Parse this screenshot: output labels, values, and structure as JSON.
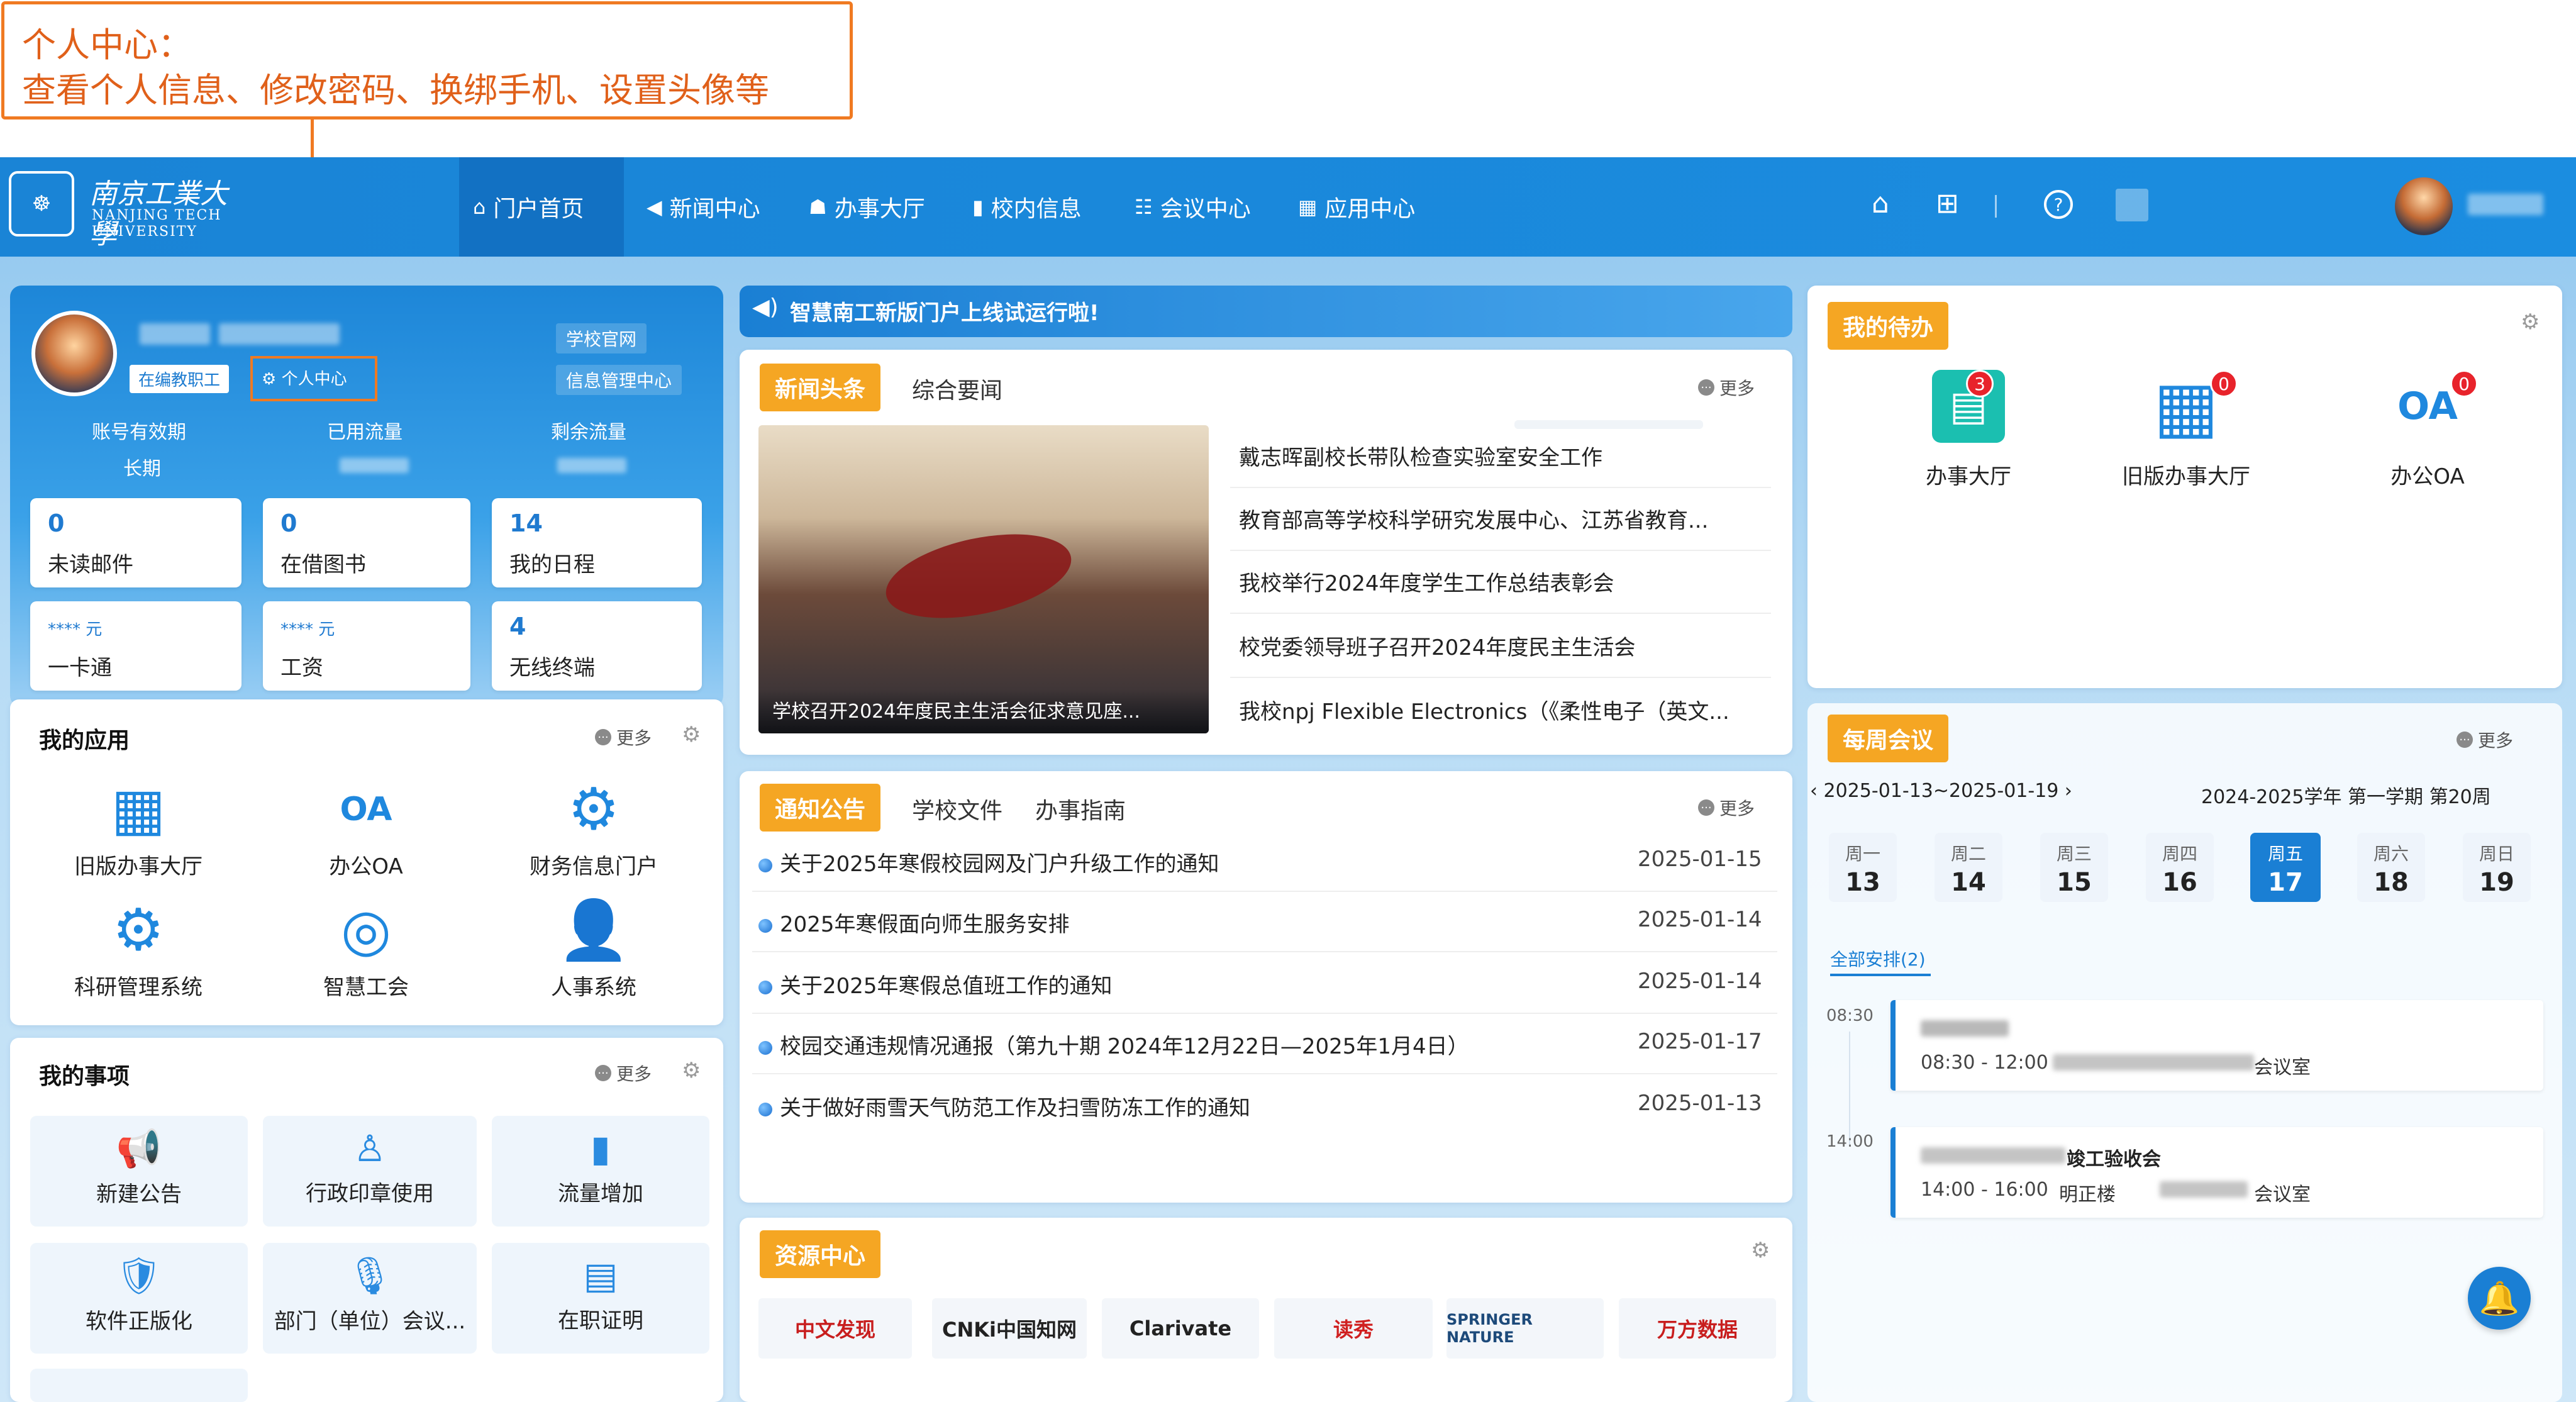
{
  "annotation": {
    "line1": "个人中心：",
    "line2": "查看个人信息、修改密码、换绑手机、设置头像等"
  },
  "logo": {
    "cn": "南京工業大學",
    "en1": "NANJING TECH",
    "en2": "UNIVERSITY"
  },
  "nav": [
    {
      "label": "门户首页",
      "icon": "⌂"
    },
    {
      "label": "新闻中心",
      "icon": "◀"
    },
    {
      "label": "办事大厅",
      "icon": "☗"
    },
    {
      "label": "校内信息",
      "icon": "▮"
    },
    {
      "label": "会议中心",
      "icon": "☷"
    },
    {
      "label": "应用中心",
      "icon": "▦"
    }
  ],
  "topbar_icons": {
    "home": "⌂",
    "grid": "⊞",
    "help": "?"
  },
  "profile": {
    "role_tag": "在编教职工",
    "personal_center": "个人中心",
    "school_site": "学校官网",
    "info_center": "信息管理中心",
    "stats_labels": [
      "账号有效期",
      "已用流量",
      "剩余流量"
    ],
    "validity_value": "长期"
  },
  "tiles": [
    {
      "num": "0",
      "label": "未读邮件"
    },
    {
      "num": "0",
      "label": "在借图书"
    },
    {
      "num": "14",
      "label": "我的日程"
    },
    {
      "num": "**** 元",
      "label": "一卡通"
    },
    {
      "num": "**** 元",
      "label": "工资"
    },
    {
      "num": "4",
      "label": "无线终端"
    }
  ],
  "my_apps": {
    "title": "我的应用",
    "more": "更多",
    "items": [
      {
        "name": "旧版办事大厅",
        "icon": "▦"
      },
      {
        "name": "办公OA",
        "icon": "OA"
      },
      {
        "name": "财务信息门户",
        "icon": "⚙"
      },
      {
        "name": "科研管理系统",
        "icon": "⚙"
      },
      {
        "name": "智慧工会",
        "icon": "◎"
      },
      {
        "name": "人事系统",
        "icon": "👤"
      }
    ]
  },
  "my_matters": {
    "title": "我的事项",
    "more": "更多",
    "items": [
      {
        "name": "新建公告",
        "icon": "📢"
      },
      {
        "name": "行政印章使用",
        "icon": "♙"
      },
      {
        "name": "流量增加",
        "icon": "▮"
      },
      {
        "name": "软件正版化",
        "icon": "🛡"
      },
      {
        "name": "部门（单位）会议...",
        "icon": "🎙"
      },
      {
        "name": "在职证明",
        "icon": "▤"
      }
    ]
  },
  "announcement": "智慧南工新版门户上线试运行啦!",
  "news": {
    "tab_active": "新闻头条",
    "tab2": "综合要闻",
    "more": "更多",
    "photo_caption": "学校召开2024年度民主生活会征求意见座...",
    "items": [
      "戴志晖副校长带队检查实验室安全工作",
      "教育部高等学校科学研究发展中心、江苏省教育...",
      "我校举行2024年度学生工作总结表彰会",
      "校党委领导班子召开2024年度民主生活会",
      "我校npj Flexible Electronics（《柔性电子（英文..."
    ]
  },
  "notices": {
    "tab_active": "通知公告",
    "tab2": "学校文件",
    "tab3": "办事指南",
    "more": "更多",
    "items": [
      {
        "title": "关于2025年寒假校园网及门户升级工作的通知",
        "date": "2025-01-15"
      },
      {
        "title": "2025年寒假面向师生服务安排",
        "date": "2025-01-14"
      },
      {
        "title": "关于2025年寒假总值班工作的通知",
        "date": "2025-01-14"
      },
      {
        "title": "校园交通违规情况通报（第九十期 2024年12月22日—2025年1月4日）",
        "date": "2025-01-17"
      },
      {
        "title": "关于做好雨雪天气防范工作及扫雪防冻工作的通知",
        "date": "2025-01-13"
      }
    ]
  },
  "resources": {
    "title": "资源中心",
    "items": [
      "中文发现",
      "CNKi中国知网",
      "Clarivate",
      "读秀",
      "SPRINGER NATURE",
      "万方数据"
    ]
  },
  "todo": {
    "title": "我的待办",
    "items": [
      {
        "name": "办事大厅",
        "badge": "3"
      },
      {
        "name": "旧版办事大厅",
        "badge": "0"
      },
      {
        "name": "办公OA",
        "badge": "0"
      }
    ]
  },
  "meetings": {
    "title": "每周会议",
    "more": "更多",
    "week_range": "2025-01-13~2025-01-19",
    "term": "2024-2025学年 第一学期 第20周",
    "days": [
      {
        "w": "周一",
        "d": "13"
      },
      {
        "w": "周二",
        "d": "14"
      },
      {
        "w": "周三",
        "d": "15"
      },
      {
        "w": "周四",
        "d": "16"
      },
      {
        "w": "周五",
        "d": "17"
      },
      {
        "w": "周六",
        "d": "18"
      },
      {
        "w": "周日",
        "d": "19"
      }
    ],
    "all_schedule": "全部安排(2)",
    "events": [
      {
        "time": "08:30",
        "range": "08:30 - 12:00",
        "title": "",
        "room": "会议室"
      },
      {
        "time": "14:00",
        "range": "14:00 - 16:00",
        "title": "竣工验收会",
        "building": "明正楼",
        "room": "会议室"
      }
    ]
  }
}
